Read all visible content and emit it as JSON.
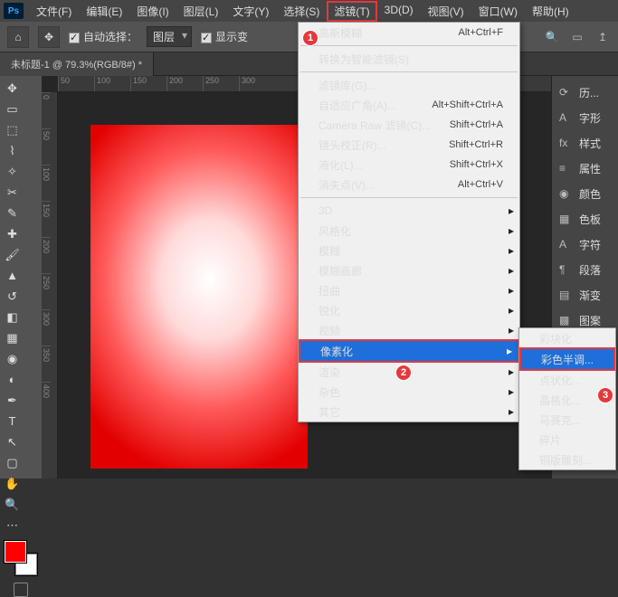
{
  "menubar": [
    "文件(F)",
    "编辑(E)",
    "图像(I)",
    "图层(L)",
    "文字(Y)",
    "选择(S)",
    "滤镜(T)",
    "3D(D)",
    "视图(V)",
    "窗口(W)",
    "帮助(H)"
  ],
  "menubar_hl_index": 6,
  "optbar": {
    "auto_select": "自动选择：",
    "layer": "图层",
    "show_transform": "显示变"
  },
  "doc_tab": "未标题-1 @ 79.3%(RGB/8#) *",
  "ruler_h": [
    "50",
    "100",
    "150",
    "200",
    "250",
    "300"
  ],
  "ruler_v": [
    "0",
    "50",
    "100",
    "150",
    "200",
    "250",
    "300",
    "350",
    "400"
  ],
  "panels": [
    "历...",
    "字形",
    "样式",
    "属性",
    "颜色",
    "色板",
    "字符",
    "段落",
    "渐变",
    "图案"
  ],
  "dropdown": [
    {
      "t": "item",
      "label": "高斯模糊",
      "shortcut": "Alt+Ctrl+F"
    },
    {
      "t": "sep"
    },
    {
      "t": "item",
      "label": "转换为智能滤镜(S)"
    },
    {
      "t": "sep"
    },
    {
      "t": "item",
      "label": "滤镜库(G)..."
    },
    {
      "t": "item",
      "label": "自适应广角(A)...",
      "shortcut": "Alt+Shift+Ctrl+A"
    },
    {
      "t": "item",
      "label": "Camera Raw 滤镜(C)...",
      "shortcut": "Shift+Ctrl+A"
    },
    {
      "t": "item",
      "label": "镜头校正(R)...",
      "shortcut": "Shift+Ctrl+R"
    },
    {
      "t": "item",
      "label": "液化(L)...",
      "shortcut": "Shift+Ctrl+X"
    },
    {
      "t": "item",
      "label": "消失点(V)...",
      "shortcut": "Alt+Ctrl+V"
    },
    {
      "t": "sep"
    },
    {
      "t": "item",
      "label": "3D",
      "sub": true
    },
    {
      "t": "item",
      "label": "风格化",
      "sub": true
    },
    {
      "t": "item",
      "label": "模糊",
      "sub": true
    },
    {
      "t": "item",
      "label": "模糊画廊",
      "sub": true
    },
    {
      "t": "item",
      "label": "扭曲",
      "sub": true
    },
    {
      "t": "item",
      "label": "锐化",
      "sub": true
    },
    {
      "t": "item",
      "label": "视频",
      "sub": true
    },
    {
      "t": "item",
      "label": "像素化",
      "sub": true,
      "sel": true,
      "hl": true
    },
    {
      "t": "item",
      "label": "渲染",
      "sub": true
    },
    {
      "t": "item",
      "label": "杂色",
      "sub": true
    },
    {
      "t": "item",
      "label": "其它",
      "sub": true
    }
  ],
  "submenu": [
    {
      "label": "彩块化"
    },
    {
      "label": "彩色半调...",
      "sel": true,
      "hl": true
    },
    {
      "label": "点状化..."
    },
    {
      "label": "晶格化..."
    },
    {
      "label": "马赛克..."
    },
    {
      "label": "碎片"
    },
    {
      "label": "铜版雕刻..."
    }
  ],
  "badges": {
    "b1": "1",
    "b2": "2",
    "b3": "3"
  }
}
